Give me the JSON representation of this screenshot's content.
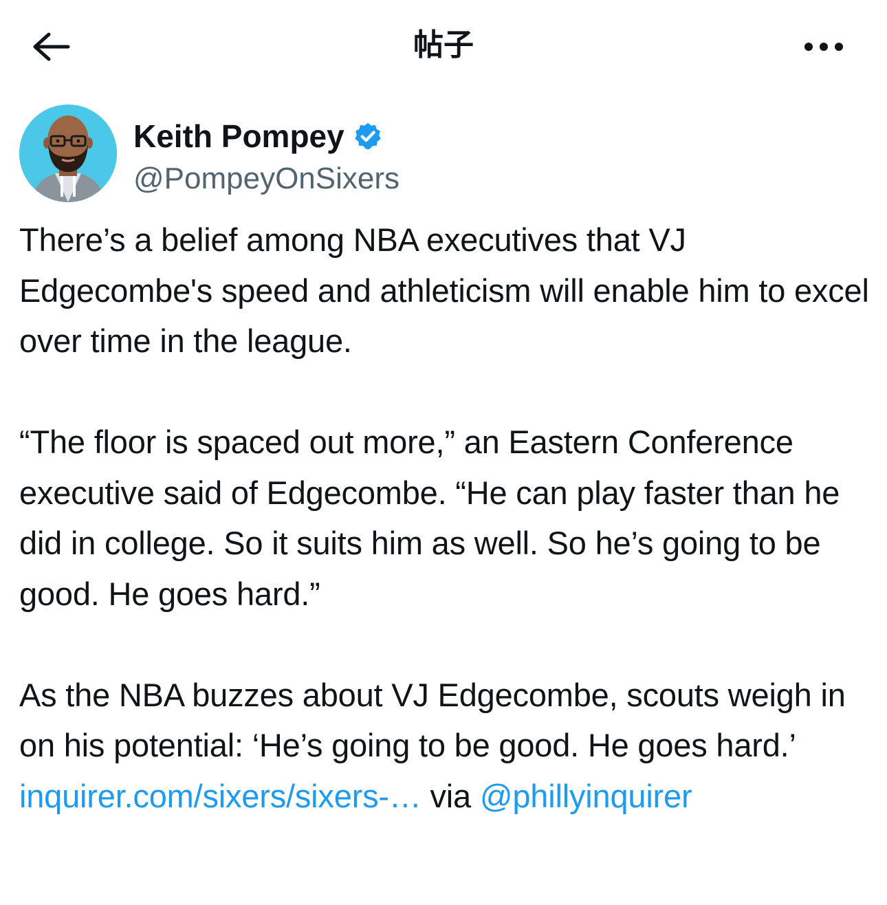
{
  "header": {
    "back_icon": "arrow-left-icon",
    "title": "帖子",
    "more_icon": "more-horizontal-icon"
  },
  "author": {
    "name": "Keith Pompey",
    "handle": "@PompeyOnSixers",
    "verified_icon": "verified-badge-icon",
    "verified_color": "#1d9bf0",
    "avatar_bg": "#4bc8e8"
  },
  "post": {
    "paragraph1": "There’s a belief among NBA executives that VJ Edgecombe's speed and athleticism will enable him to excel over time in the league.",
    "paragraph2": "“The floor is spaced out more,” an Eastern Conference executive said of Edgecombe. “He can play faster than he did in college. So it suits him as well. So he’s going to be good. He goes hard.”",
    "paragraph3_text": "As the NBA buzzes about VJ Edgecombe, scouts weigh in on his potential: ‘He’s going to be good. He goes hard.’ ",
    "link_text": "inquirer.com/sixers/sixers-…",
    "via_text": " via ",
    "mention_text": "@phillyinquirer"
  },
  "colors": {
    "text": "#0f1419",
    "secondary": "#536471",
    "link": "#1d9bf0"
  }
}
